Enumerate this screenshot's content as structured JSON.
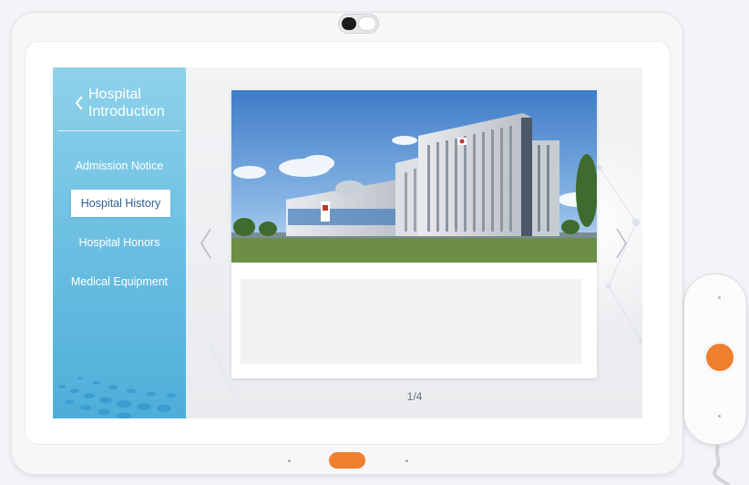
{
  "sidebar": {
    "title": "Hospital Introduction",
    "items": [
      {
        "label": "Admission Notice",
        "active": false
      },
      {
        "label": "Hospital History",
        "active": true
      },
      {
        "label": "Hospital Honors",
        "active": false
      },
      {
        "label": "Medical Equipment",
        "active": false
      }
    ]
  },
  "carousel": {
    "page_indicator": "1/4",
    "image_subject": "hospital building"
  },
  "icons": {
    "back": "chevron-left-icon",
    "prev": "chevron-left-icon",
    "next": "chevron-right-icon"
  },
  "colors": {
    "sidebar_top": "#8fd2ea",
    "sidebar_bottom": "#4eaed9",
    "accent_orange": "#f07f2e",
    "active_item_text": "#2a5e8c"
  }
}
